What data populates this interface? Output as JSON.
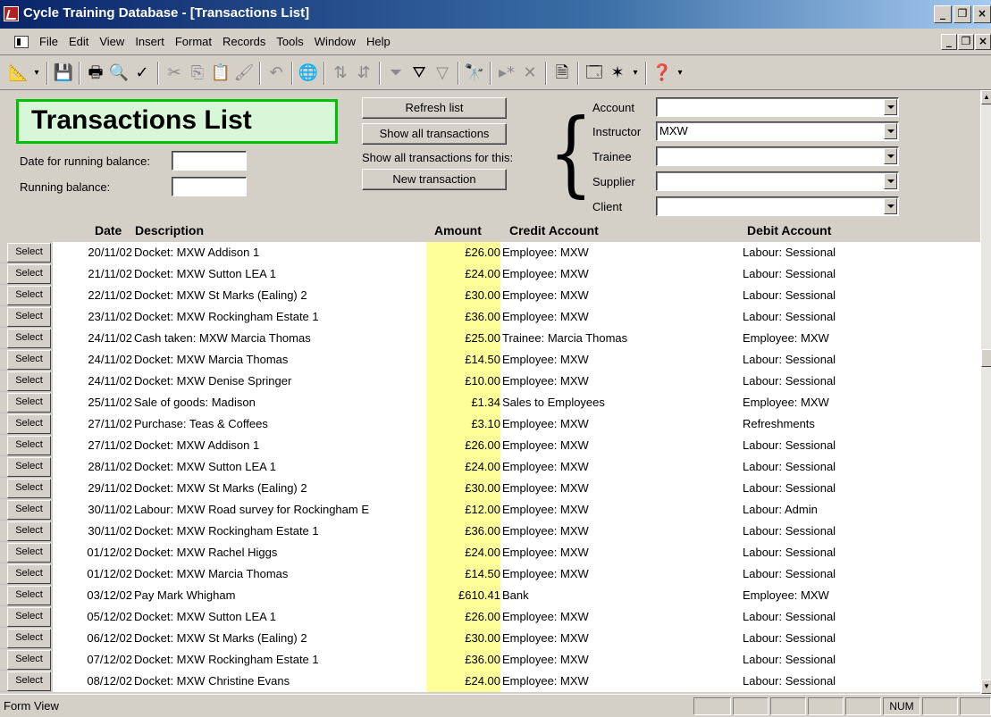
{
  "window": {
    "title": "Cycle Training Database - [Transactions List]"
  },
  "menu": [
    "File",
    "Edit",
    "View",
    "Insert",
    "Format",
    "Records",
    "Tools",
    "Window",
    "Help"
  ],
  "toolbar_icons": [
    "view-icon",
    "save-icon",
    "print-icon",
    "print-preview-icon",
    "spelling-icon",
    "cut-icon",
    "copy-icon",
    "paste-icon",
    "format-painter-icon",
    "undo-icon",
    "hyperlink-icon",
    "sort-ascending-icon",
    "sort-descending-icon",
    "filter-by-selection-icon",
    "filter-by-form-icon",
    "apply-filter-icon",
    "find-icon",
    "new-record-icon",
    "delete-record-icon",
    "properties-icon",
    "database-window-icon",
    "new-object-icon",
    "help-icon"
  ],
  "form": {
    "heading": "Transactions List",
    "buttons": {
      "refresh": "Refresh list",
      "show_all": "Show all transactions",
      "new_transaction": "New transaction"
    },
    "show_for_label": "Show all transactions for this:",
    "date_running_label": "Date for running balance:",
    "running_balance_label": "Running balance:",
    "filters": [
      {
        "label": "Account",
        "value": ""
      },
      {
        "label": "Instructor",
        "value": "MXW"
      },
      {
        "label": "Trainee",
        "value": ""
      },
      {
        "label": "Supplier",
        "value": ""
      },
      {
        "label": "Client",
        "value": ""
      }
    ]
  },
  "table": {
    "columns": {
      "date": "Date",
      "description": "Description",
      "amount": "Amount",
      "credit": "Credit Account",
      "debit": "Debit Account"
    },
    "select_label": "Select",
    "rows": [
      {
        "date": "20/11/02",
        "description": "Docket: MXW Addison  1",
        "amount": "£26.00",
        "credit": "Employee: MXW",
        "debit": "Labour: Sessional"
      },
      {
        "date": "21/11/02",
        "description": "Docket: MXW Sutton LEA  1",
        "amount": "£24.00",
        "credit": "Employee: MXW",
        "debit": "Labour: Sessional"
      },
      {
        "date": "22/11/02",
        "description": "Docket: MXW St Marks (Ealing)  2",
        "amount": "£30.00",
        "credit": "Employee: MXW",
        "debit": "Labour: Sessional"
      },
      {
        "date": "23/11/02",
        "description": "Docket: MXW Rockingham Estate  1",
        "amount": "£36.00",
        "credit": "Employee: MXW",
        "debit": "Labour: Sessional"
      },
      {
        "date": "24/11/02",
        "description": "Cash taken: MXW Marcia Thomas",
        "amount": "£25.00",
        "credit": "Trainee: Marcia Thomas",
        "debit": "Employee: MXW"
      },
      {
        "date": "24/11/02",
        "description": "Docket: MXW Marcia Thomas",
        "amount": "£14.50",
        "credit": "Employee: MXW",
        "debit": "Labour: Sessional"
      },
      {
        "date": "24/11/02",
        "description": "Docket: MXW Denise Springer",
        "amount": "£10.00",
        "credit": "Employee: MXW",
        "debit": "Labour: Sessional"
      },
      {
        "date": "25/11/02",
        "description": "Sale of goods: Madison",
        "amount": "£1.34",
        "credit": "Sales to Employees",
        "debit": "Employee: MXW"
      },
      {
        "date": "27/11/02",
        "description": "Purchase: Teas & Coffees",
        "amount": "£3.10",
        "credit": "Employee: MXW",
        "debit": "Refreshments"
      },
      {
        "date": "27/11/02",
        "description": "Docket: MXW Addison  1",
        "amount": "£26.00",
        "credit": "Employee: MXW",
        "debit": "Labour: Sessional"
      },
      {
        "date": "28/11/02",
        "description": "Docket: MXW Sutton LEA  1",
        "amount": "£24.00",
        "credit": "Employee: MXW",
        "debit": "Labour: Sessional"
      },
      {
        "date": "29/11/02",
        "description": "Docket: MXW St Marks (Ealing)  2",
        "amount": "£30.00",
        "credit": "Employee: MXW",
        "debit": "Labour: Sessional"
      },
      {
        "date": "30/11/02",
        "description": "Labour: MXW Road survey for Rockingham E",
        "amount": "£12.00",
        "credit": "Employee: MXW",
        "debit": "Labour: Admin"
      },
      {
        "date": "30/11/02",
        "description": "Docket: MXW Rockingham Estate  1",
        "amount": "£36.00",
        "credit": "Employee: MXW",
        "debit": "Labour: Sessional"
      },
      {
        "date": "01/12/02",
        "description": "Docket: MXW Rachel Higgs",
        "amount": "£24.00",
        "credit": "Employee: MXW",
        "debit": "Labour: Sessional"
      },
      {
        "date": "01/12/02",
        "description": "Docket: MXW Marcia Thomas",
        "amount": "£14.50",
        "credit": "Employee: MXW",
        "debit": "Labour: Sessional"
      },
      {
        "date": "03/12/02",
        "description": "Pay Mark Whigham",
        "amount": "£610.41",
        "credit": "Bank",
        "debit": "Employee: MXW"
      },
      {
        "date": "05/12/02",
        "description": "Docket: MXW Sutton LEA  1",
        "amount": "£26.00",
        "credit": "Employee: MXW",
        "debit": "Labour: Sessional"
      },
      {
        "date": "06/12/02",
        "description": "Docket: MXW St Marks (Ealing)  2",
        "amount": "£30.00",
        "credit": "Employee: MXW",
        "debit": "Labour: Sessional"
      },
      {
        "date": "07/12/02",
        "description": "Docket: MXW Rockingham Estate  1",
        "amount": "£36.00",
        "credit": "Employee: MXW",
        "debit": "Labour: Sessional"
      },
      {
        "date": "08/12/02",
        "description": "Docket: MXW Christine Evans",
        "amount": "£24.00",
        "credit": "Employee: MXW",
        "debit": "Labour: Sessional"
      }
    ]
  },
  "status": {
    "text": "Form View",
    "num": "NUM"
  }
}
